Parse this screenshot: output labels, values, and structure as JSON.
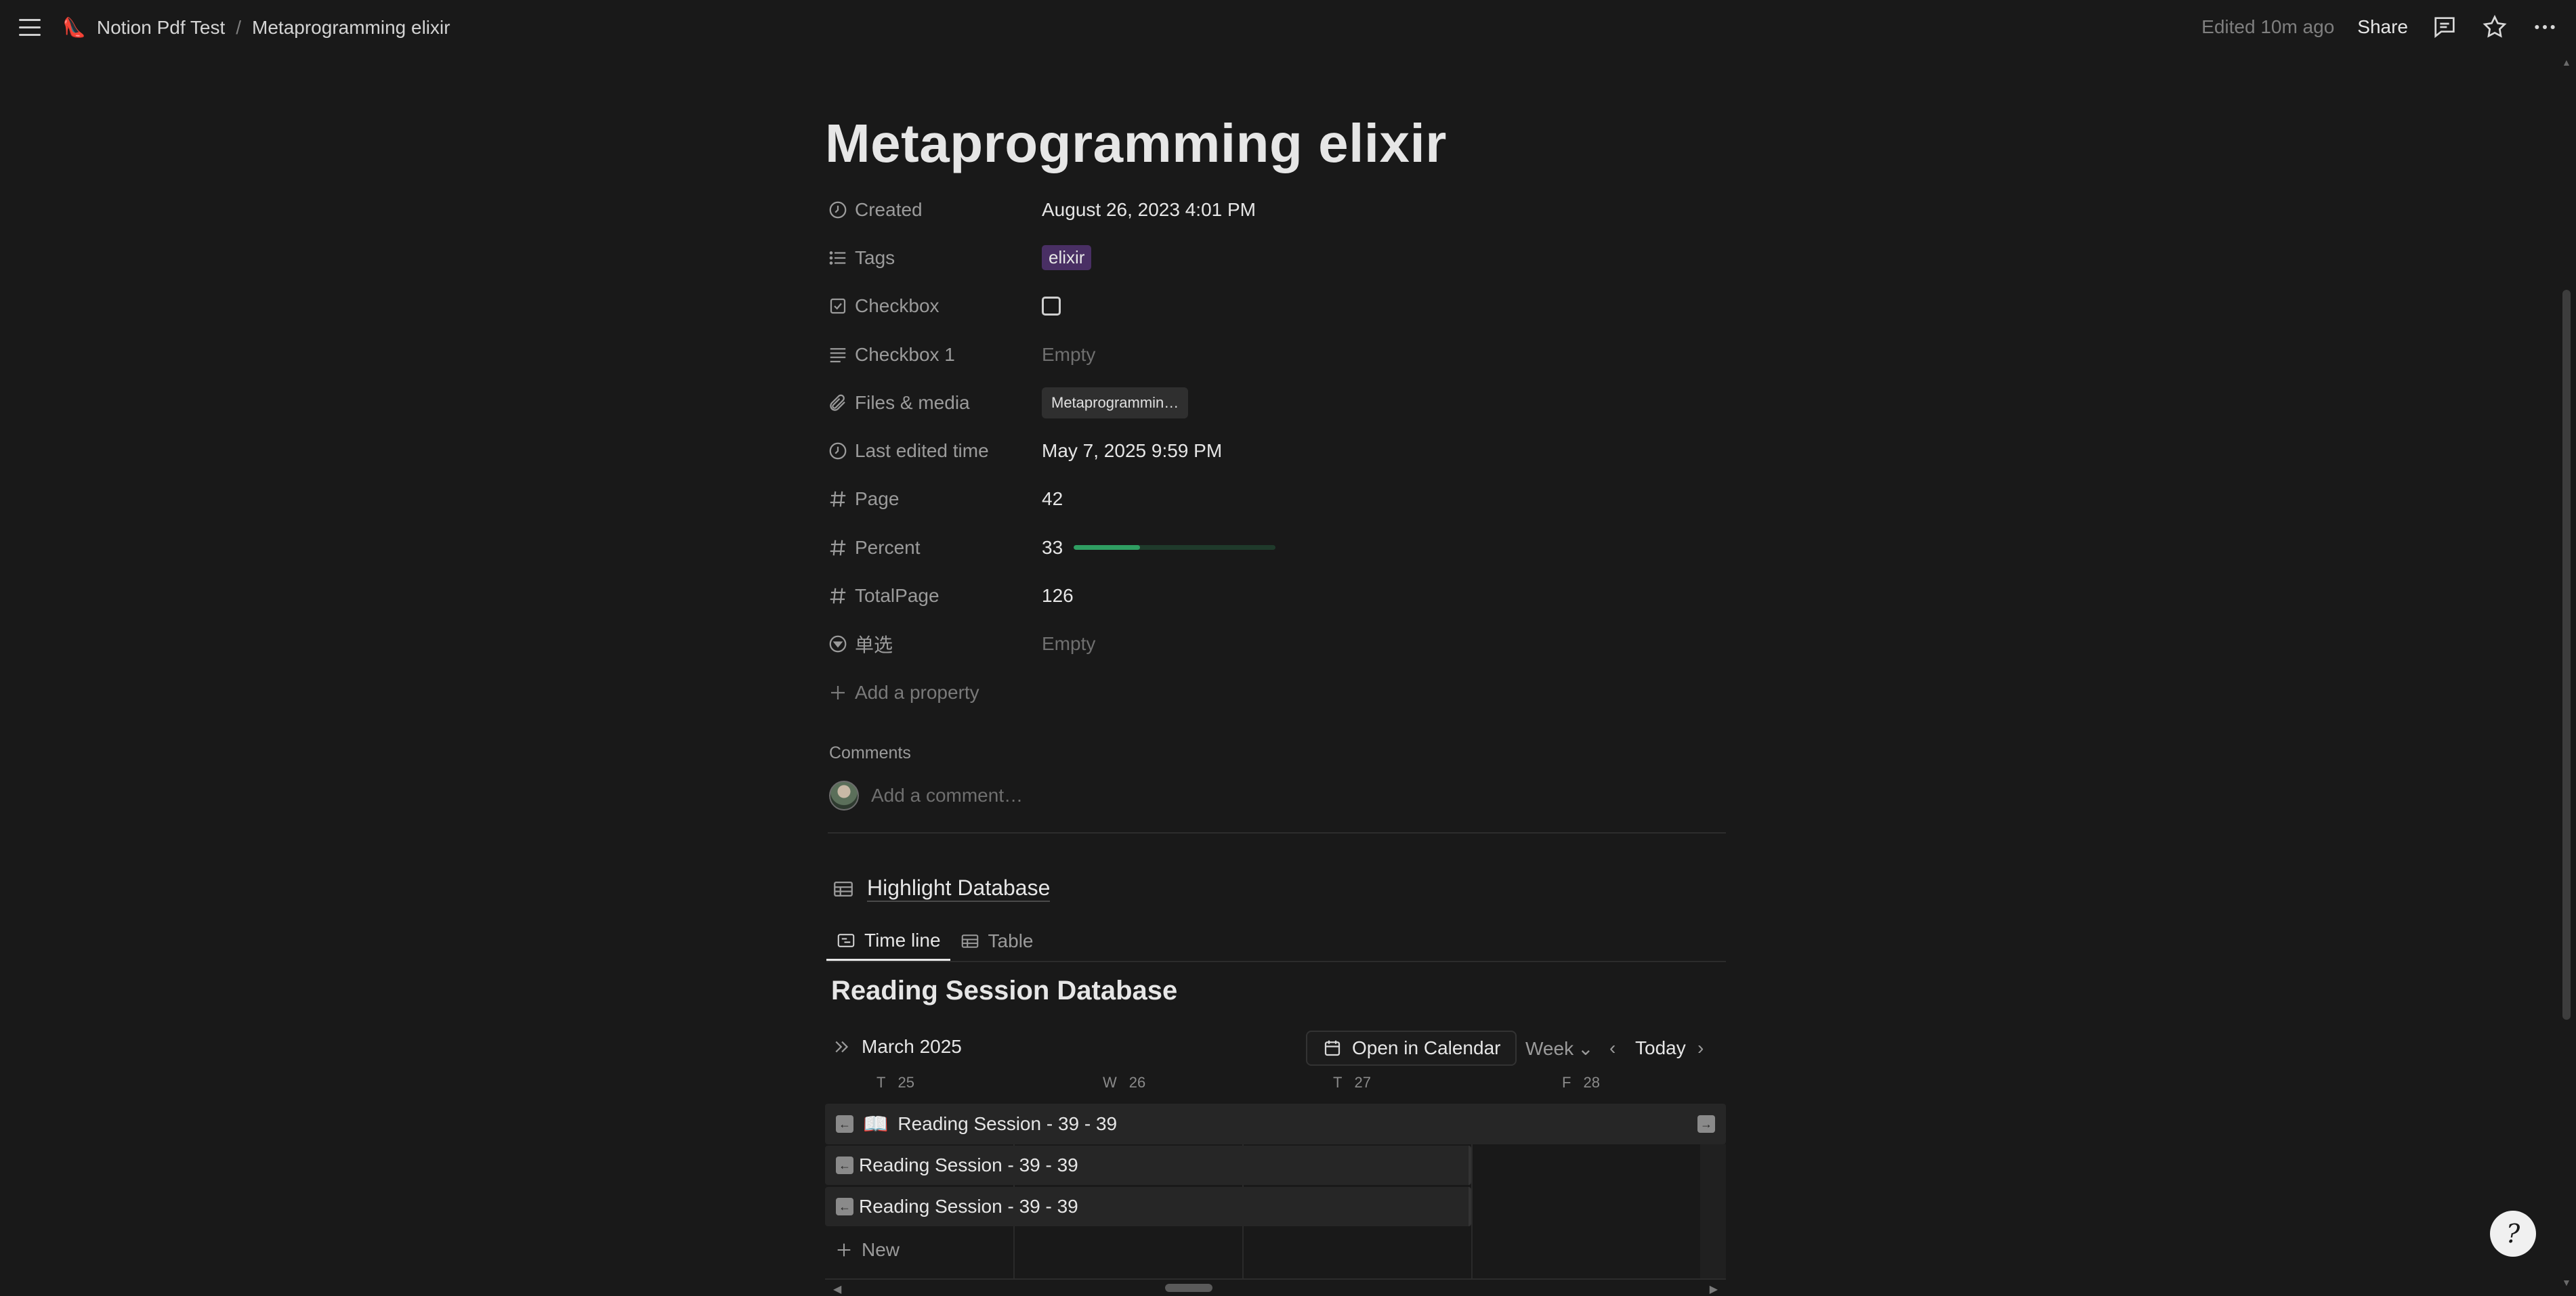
{
  "topbar": {
    "workspace_icon": "👠",
    "workspace": "Notion Pdf Test",
    "separator": "/",
    "page": "Metaprogramming elixir",
    "edited": "Edited 10m ago",
    "share": "Share"
  },
  "page": {
    "title": "Metaprogramming elixir",
    "properties": [
      {
        "name": "Created",
        "icon": "clock-icon",
        "value": "August 26, 2023 4:01 PM"
      },
      {
        "name": "Tags",
        "icon": "list-icon",
        "value": "elixir"
      },
      {
        "name": "Checkbox",
        "icon": "checkbox-icon",
        "value": ""
      },
      {
        "name": "Checkbox 1",
        "icon": "text-lines-icon",
        "value": "Empty"
      },
      {
        "name": "Files & media",
        "icon": "paperclip-icon",
        "value": "Metaprogrammin…"
      },
      {
        "name": "Last edited time",
        "icon": "clock-icon",
        "value": "May 7, 2025 9:59 PM"
      },
      {
        "name": "Page",
        "icon": "hash-icon",
        "value": "42"
      },
      {
        "name": "Percent",
        "icon": "hash-icon",
        "value": "33",
        "progress": 0.33
      },
      {
        "name": "TotalPage",
        "icon": "hash-icon",
        "value": "126"
      },
      {
        "name": "单选",
        "icon": "select-icon",
        "value": "Empty"
      }
    ],
    "add_property": "Add a property",
    "comments_label": "Comments",
    "comment_placeholder": "Add a comment…"
  },
  "database": {
    "title": "Highlight Database",
    "tabs": [
      {
        "label": "Time line",
        "icon": "timeline-icon",
        "active": true
      },
      {
        "label": "Table",
        "icon": "table-icon",
        "active": false
      }
    ],
    "heading": "Reading Session Database",
    "toolbar": {
      "month": "March 2025",
      "open_calendar": "Open in Calendar",
      "week": "Week",
      "today": "Today"
    },
    "days": [
      {
        "letter": "T",
        "num": "25"
      },
      {
        "letter": "W",
        "num": "26"
      },
      {
        "letter": "T",
        "num": "27"
      },
      {
        "letter": "F",
        "num": "28"
      }
    ],
    "sessions": [
      {
        "label": "Reading Session - 39 - 39",
        "icon": "📖"
      },
      {
        "label": "Reading Session - 39 - 39"
      },
      {
        "label": "Reading Session - 39 - 39"
      }
    ],
    "new_label": "New"
  },
  "colors": {
    "background": "#191919",
    "tag_bg": "#492f64",
    "progress": "#2f9e62"
  }
}
